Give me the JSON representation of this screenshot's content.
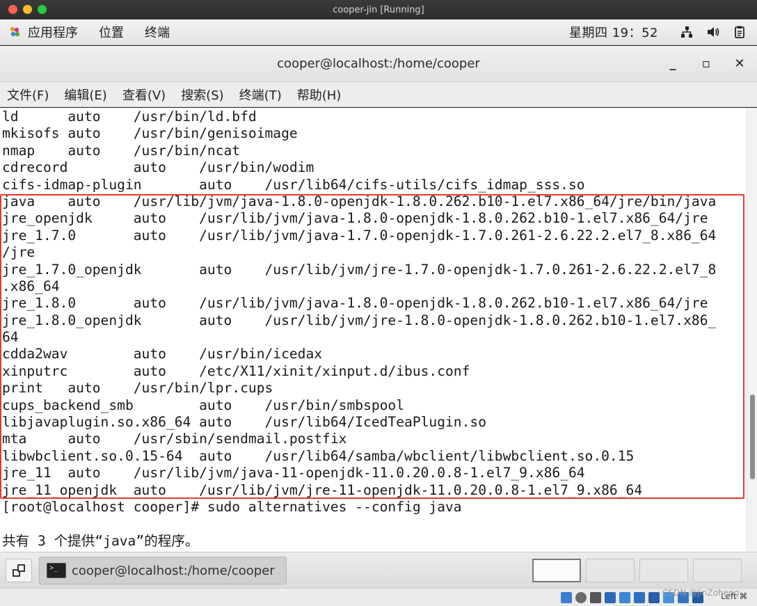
{
  "host_window": {
    "title": "cooper-jin [Running]"
  },
  "panel": {
    "menus": [
      "应用程序",
      "位置",
      "终端"
    ],
    "clock": "星期四 19：52"
  },
  "terminal": {
    "title": "cooper@localhost:/home/cooper",
    "window_buttons": {
      "minimize": "_",
      "maximize": "▫",
      "close": "✕"
    },
    "menu": [
      "文件(F)",
      "编辑(E)",
      "查看(V)",
      "搜索(S)",
      "终端(T)",
      "帮助(H)"
    ],
    "lines": [
      "ld      auto    /usr/bin/ld.bfd",
      "mkisofs auto    /usr/bin/genisoimage",
      "nmap    auto    /usr/bin/ncat",
      "cdrecord        auto    /usr/bin/wodim",
      "cifs-idmap-plugin       auto    /usr/lib64/cifs-utils/cifs_idmap_sss.so",
      "java    auto    /usr/lib/jvm/java-1.8.0-openjdk-1.8.0.262.b10-1.el7.x86_64/jre/bin/java",
      "jre_openjdk     auto    /usr/lib/jvm/java-1.8.0-openjdk-1.8.0.262.b10-1.el7.x86_64/jre",
      "jre_1.7.0       auto    /usr/lib/jvm/java-1.7.0-openjdk-1.7.0.261-2.6.22.2.el7_8.x86_64",
      "/jre",
      "jre_1.7.0_openjdk       auto    /usr/lib/jvm/jre-1.7.0-openjdk-1.7.0.261-2.6.22.2.el7_8",
      ".x86_64",
      "jre_1.8.0       auto    /usr/lib/jvm/java-1.8.0-openjdk-1.8.0.262.b10-1.el7.x86_64/jre",
      "jre_1.8.0_openjdk       auto    /usr/lib/jvm/jre-1.8.0-openjdk-1.8.0.262.b10-1.el7.x86_",
      "64",
      "cdda2wav        auto    /usr/bin/icedax",
      "xinputrc        auto    /etc/X11/xinit/xinput.d/ibus.conf",
      "print   auto    /usr/bin/lpr.cups",
      "cups_backend_smb        auto    /usr/bin/smbspool",
      "libjavaplugin.so.x86_64 auto    /usr/lib64/IcedTeaPlugin.so",
      "mta     auto    /usr/sbin/sendmail.postfix",
      "libwbclient.so.0.15-64  auto    /usr/lib64/samba/wbclient/libwbclient.so.0.15",
      "jre_11  auto    /usr/lib/jvm/java-11-openjdk-11.0.20.0.8-1.el7_9.x86_64",
      "jre_11_openjdk  auto    /usr/lib/jvm/jre-11-openjdk-11.0.20.0.8-1.el7_9.x86_64",
      "[root@localhost cooper]# sudo alternatives --config java",
      "",
      "共有 3 个提供“java”的程序。"
    ]
  },
  "taskbar": {
    "task_label": "cooper@localhost:/home/cooper"
  },
  "vbox_status": {
    "host_key": "Left ⌘"
  },
  "watermark": "CSDN @JinZoheng",
  "colors": {
    "highlight": "#e13d2c"
  }
}
